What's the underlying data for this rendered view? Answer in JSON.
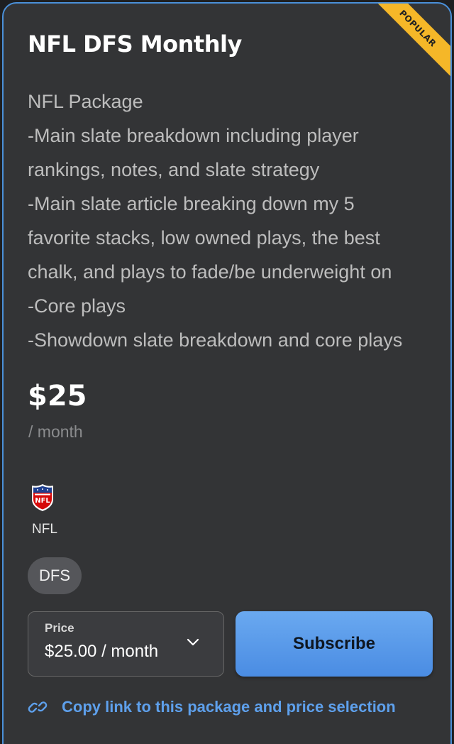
{
  "card": {
    "badge": "POPULAR",
    "title": "NFL DFS Monthly",
    "description": [
      "NFL Package",
      "-Main slate breakdown including player",
      "rankings, notes, and slate strategy",
      "-Main slate article breaking down my 5",
      "favorite stacks, low owned plays, the best",
      "chalk, and plays to fade/be underweight on",
      "-Core plays",
      "-Showdown slate breakdown and core plays"
    ],
    "price": "$25",
    "period": "/ month",
    "league": {
      "icon": "nfl-logo-icon",
      "name": "NFL",
      "logo_text": "NFL"
    },
    "tag": "DFS",
    "price_select": {
      "label": "Price",
      "value": "$25.00 / month"
    },
    "subscribe_label": "Subscribe",
    "copy_link_label": "Copy link to this package and price selection"
  },
  "colors": {
    "card_bg": "#333436",
    "border_accent": "#4a90d9",
    "badge_bg": "#f5b728",
    "button_blue": "#5a9be9",
    "link_blue": "#5ea0ec"
  }
}
